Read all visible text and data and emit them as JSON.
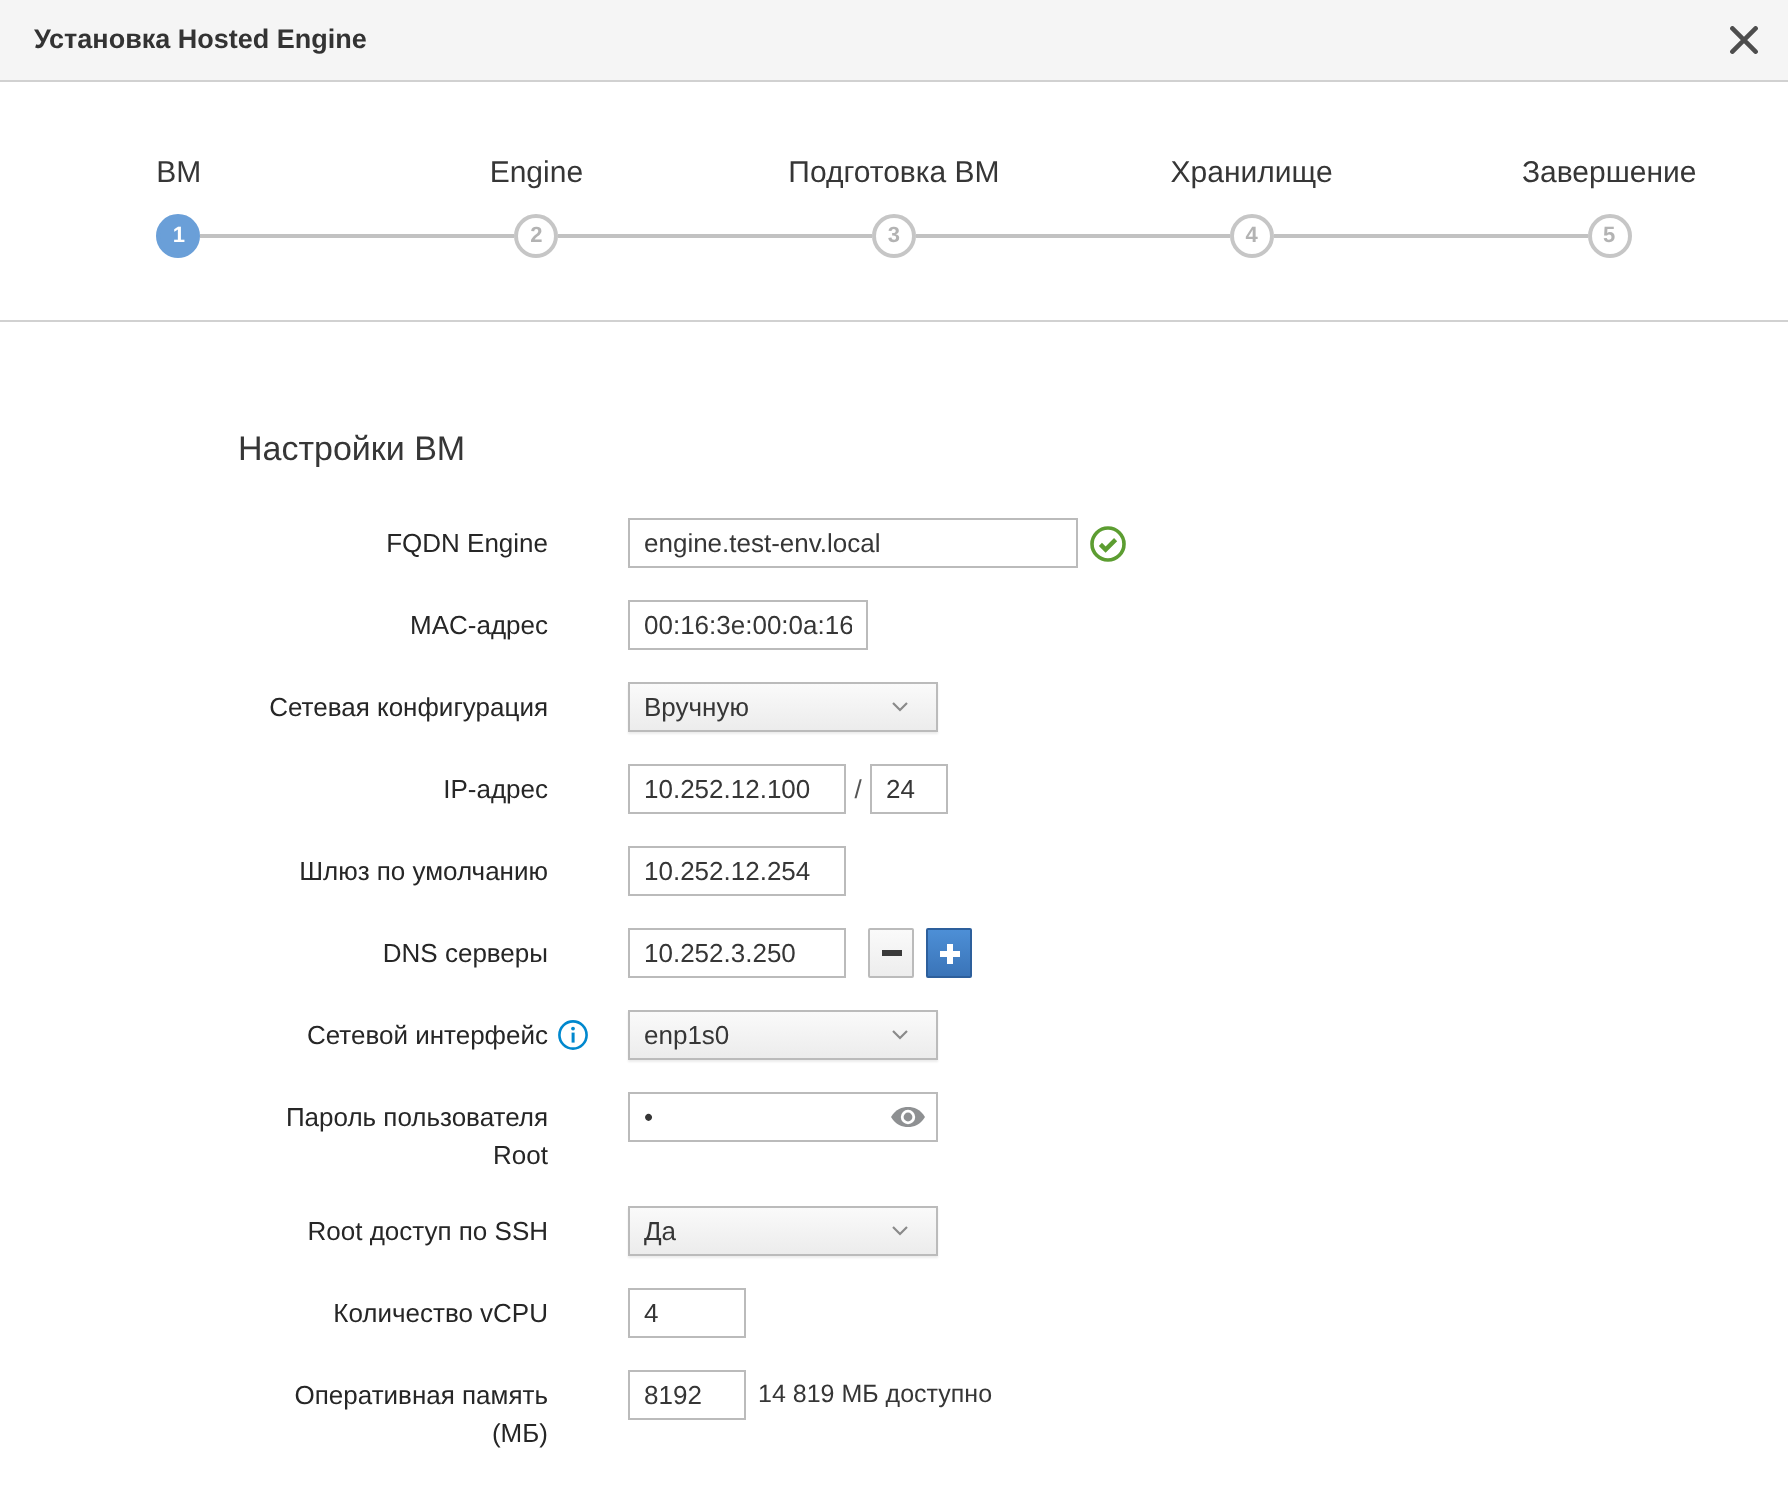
{
  "dialog": {
    "title": "Установка Hosted Engine"
  },
  "steps": [
    {
      "number": "1",
      "label": "ВМ",
      "selected": true
    },
    {
      "number": "2",
      "label": "Engine",
      "selected": false
    },
    {
      "number": "3",
      "label": "Подготовка ВМ",
      "selected": false
    },
    {
      "number": "4",
      "label": "Хранилище",
      "selected": false
    },
    {
      "number": "5",
      "label": "Завершение",
      "selected": false
    }
  ],
  "form": {
    "title": "Настройки ВМ",
    "groups": [
      {
        "fields": [
          {
            "kind": "text",
            "label": "FQDN Engine",
            "value": "engine.test-env.local",
            "valid": true
          },
          {
            "kind": "text",
            "label": "MAC-адрес",
            "value": "00:16:3e:00:0a:16"
          },
          {
            "kind": "select",
            "label": "Сетевая конфигурация",
            "value": "Вручную"
          },
          {
            "kind": "cidr",
            "label": "IP-адрес",
            "value": "10.252.12.100",
            "separator": "/",
            "prefix": "24"
          },
          {
            "kind": "text",
            "label": "Шлюз по умолчанию",
            "value": "10.252.12.254"
          },
          {
            "kind": "multi",
            "label": "DNS серверы",
            "value": "10.252.3.250"
          }
        ]
      },
      {
        "fields": [
          {
            "kind": "select",
            "label": "Сетевой интерфейс",
            "value": "enp1s0",
            "info": true
          },
          {
            "kind": "password",
            "label": "Пароль пользователя Root",
            "value": "•"
          },
          {
            "kind": "select",
            "label": "Root доступ по SSH",
            "value": "Да"
          },
          {
            "kind": "text",
            "label": "Количество vCPU",
            "value": "4"
          },
          {
            "kind": "text",
            "label": "Оперативная память (МБ)",
            "value": "8192",
            "note": "14 819 МБ доступно"
          }
        ]
      }
    ]
  }
}
